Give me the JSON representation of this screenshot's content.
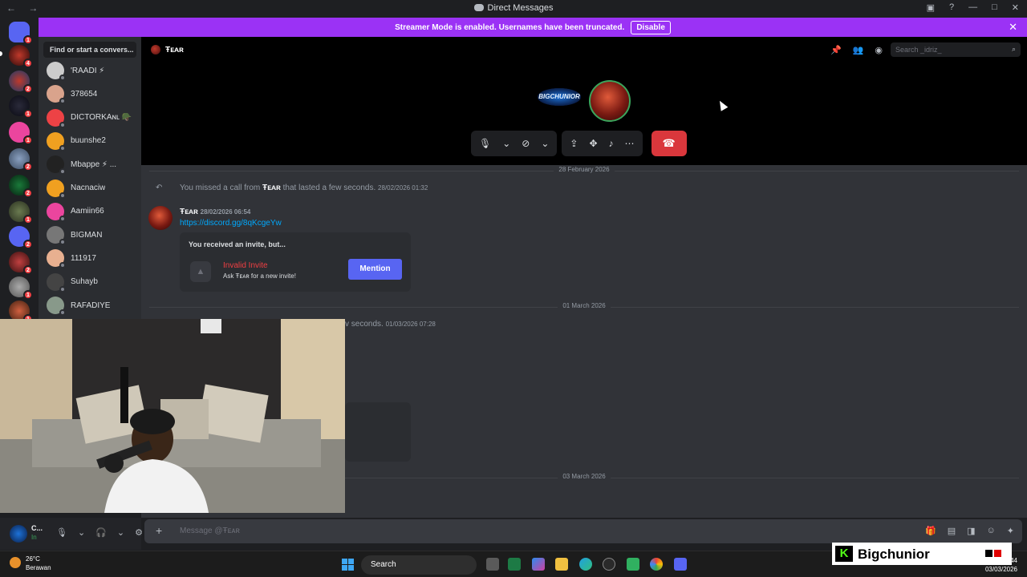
{
  "window": {
    "title": "Direct Messages",
    "nav_label": "← →"
  },
  "banner": {
    "text": "Streamer Mode is enabled. Usernames have been truncated.",
    "button": "Disable"
  },
  "server_rail": {
    "badges": [
      "1",
      "4",
      "2",
      "1",
      "1",
      "2",
      "2",
      "1",
      "2",
      "2",
      "1",
      "1"
    ]
  },
  "dm_list": {
    "search_placeholder": "Find or start a convers...",
    "items": [
      {
        "name": "'RAADI ⚡",
        "color": "#cccccc"
      },
      {
        "name": "378654",
        "color": "#d9a38c"
      },
      {
        "name": "DICTORKAɴʟ 🪖",
        "color": "#ed4245"
      },
      {
        "name": "buunshe2",
        "color": "#f0a020"
      },
      {
        "name": "Mbappe ⚡ ...",
        "color": "#222222"
      },
      {
        "name": "Nacnaciw",
        "color": "#f0a020"
      },
      {
        "name": "Aamiin66",
        "color": "#eb459e"
      },
      {
        "name": "BIGMAN",
        "color": "#777777"
      },
      {
        "name": "111917",
        "color": "#e8b090"
      },
      {
        "name": "Suhayb",
        "color": "#444444"
      },
      {
        "name": "RAFADIYE",
        "color": "#88998a"
      }
    ]
  },
  "call": {
    "channel_name": "Ŧᴇᴀʀ",
    "search_placeholder": "Search _idriz_",
    "avatar_label": "BIGCHUNIOR"
  },
  "messages": {
    "dividers": [
      "28 February 2026",
      "01 March 2026",
      "03 March 2026"
    ],
    "missed_call_1": {
      "prefix": "You missed a call from ",
      "user": "Ŧᴇᴀʀ",
      "suffix": " that lasted a few seconds.",
      "time": "28/02/2026 01:32"
    },
    "message_1": {
      "author": "Ŧᴇᴀʀ",
      "time": "28/02/2026 06:54",
      "link": "https://discord.gg/8qKcgeYw"
    },
    "invite": {
      "header": "You received an invite, but...",
      "title": "Invalid Invite",
      "subtitle": "Ask Ŧᴇᴀʀ for a new invite!",
      "button": "Mention"
    },
    "missed_call_2": {
      "suffix": "v seconds.",
      "time": "01/03/2026 07:28"
    }
  },
  "composer": {
    "placeholder": "Message @Ŧᴇᴀʀ"
  },
  "user_panel": {
    "name": "C...",
    "status": "In"
  },
  "taskbar": {
    "temp": "26°C",
    "weather": "Berawan",
    "search": "Search",
    "time_partial": "44",
    "date": "03/03/2026"
  },
  "overlay": {
    "logo": "K",
    "name": "Bigchunior"
  },
  "colors": {
    "banner": "#9b32f5",
    "hangup": "#da373c",
    "mention": "#5865f2",
    "link": "#00a8fc",
    "invalid": "#f23f43"
  }
}
